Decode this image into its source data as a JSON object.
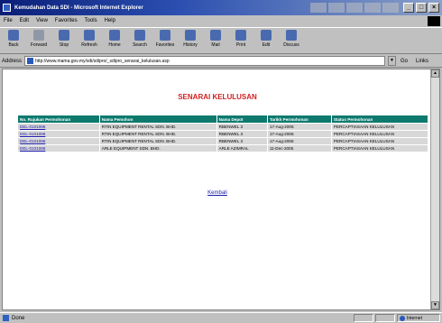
{
  "window": {
    "title": "Kemudahan Data SDI - Microsoft Internet Explorer",
    "minimize": "_",
    "maximize": "□",
    "close": "×"
  },
  "menu": [
    "File",
    "Edit",
    "View",
    "Favorites",
    "Tools",
    "Help"
  ],
  "toolbar": [
    {
      "label": "Back",
      "icon": "back-arrow-icon"
    },
    {
      "label": "Forward",
      "icon": "forward-arrow-icon"
    },
    {
      "label": "Stop",
      "icon": "stop-icon"
    },
    {
      "label": "Refresh",
      "icon": "refresh-icon"
    },
    {
      "label": "Home",
      "icon": "home-icon"
    },
    {
      "label": "Search",
      "icon": "search-icon"
    },
    {
      "label": "Favorites",
      "icon": "favorites-icon"
    },
    {
      "label": "History",
      "icon": "history-icon"
    },
    {
      "label": "Mail",
      "icon": "mail-icon"
    },
    {
      "label": "Print",
      "icon": "print-icon"
    },
    {
      "label": "Edit",
      "icon": "edit-icon"
    },
    {
      "label": "Discuss",
      "icon": "discuss-icon"
    }
  ],
  "address": {
    "label": "Address",
    "url": "http://www.mama.gov.my/sdi/sdipro/_sdipro_senarai_kelulusan.asp",
    "go": "Go",
    "links": "Links"
  },
  "page": {
    "title": "SENARAI KELULUSAN",
    "columns": [
      "No. Rujukan Permohonan",
      "Nama Pemohon",
      "Nama Depot",
      "Tarikh Permohonan",
      "Status Permohonan"
    ],
    "rows": [
      [
        "DEL-0101086",
        "RTIN EQUIPMENT RENTAL SDN. BHD.",
        "RBENWEL 3",
        "17-Aug-2006",
        "PERCAPTIASAAN KELULUSAN"
      ],
      [
        "DEL-0101086",
        "RTIN EQUIPMENT RENTAL SDN. BHD.",
        "RBENWEL 3",
        "17-Aug-2006",
        "PERCAPTIASAAN KELULUSAN"
      ],
      [
        "DEL-0101086",
        "RTIN EQUIPMENT RENTAL SDN. BHD.",
        "RBENWEL 3",
        "17-Aug-2006",
        "PERCAPTIASAAN KELULUSAN"
      ],
      [
        "DEL-0101086",
        "ARLE EQUIPMENT SDN. BHD.",
        "ARLE AZIMRAL",
        "11-Dec-2005",
        "PERCAPTIASAAN KELULUSAN"
      ]
    ],
    "back": "Kembali"
  },
  "status": {
    "text": "Done",
    "zone": "Internet"
  }
}
